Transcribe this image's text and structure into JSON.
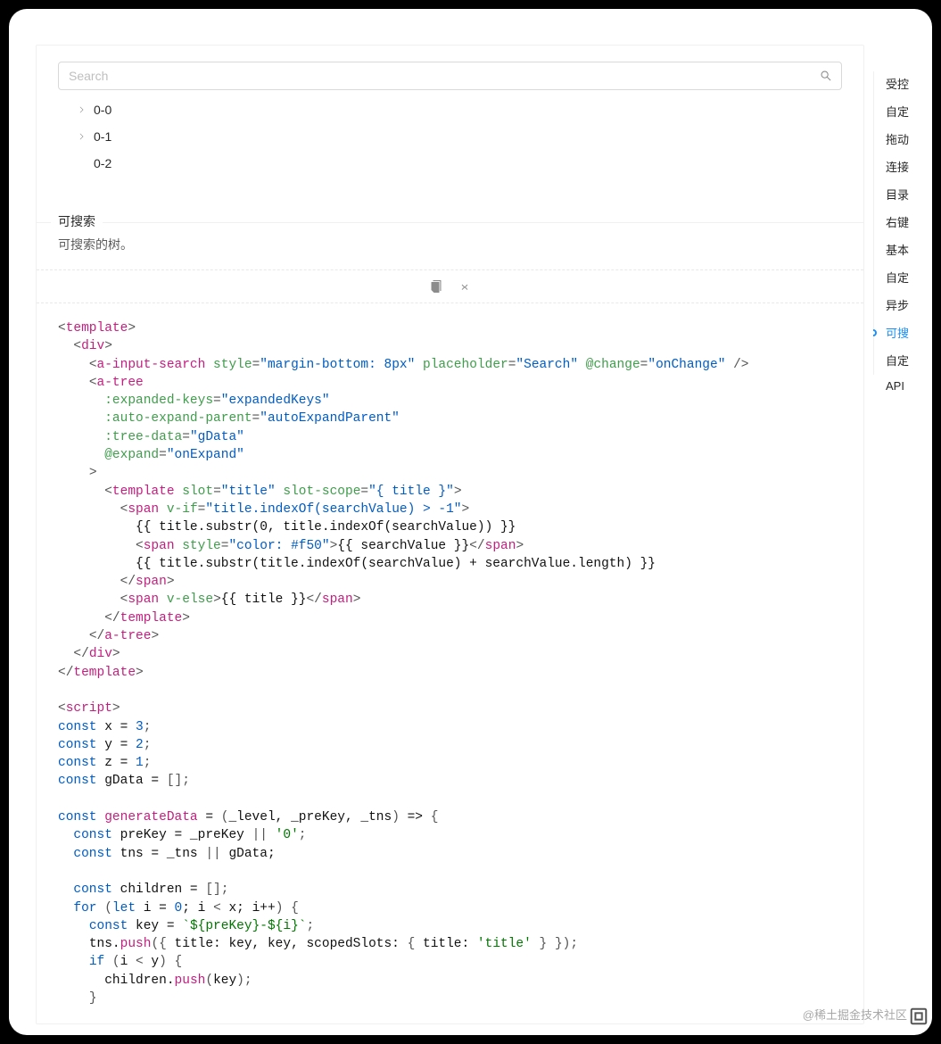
{
  "search": {
    "placeholder": "Search"
  },
  "tree": {
    "items": [
      {
        "title": "0-0",
        "hasChildren": true
      },
      {
        "title": "0-1",
        "hasChildren": true
      },
      {
        "title": "0-2",
        "hasChildren": false
      }
    ]
  },
  "meta": {
    "title": "可搜索",
    "desc": "可搜索的树。"
  },
  "code": {
    "tokens": [
      {
        "t": "<",
        "c": "punct"
      },
      {
        "t": "template",
        "c": "red"
      },
      {
        "t": ">",
        "c": "punct"
      },
      {
        "t": "\n  ",
        "c": "text"
      },
      {
        "t": "<",
        "c": "punct"
      },
      {
        "t": "div",
        "c": "red"
      },
      {
        "t": ">",
        "c": "punct"
      },
      {
        "t": "\n    ",
        "c": "text"
      },
      {
        "t": "<",
        "c": "punct"
      },
      {
        "t": "a-input-search",
        "c": "red"
      },
      {
        "t": " ",
        "c": "text"
      },
      {
        "t": "style",
        "c": "attr"
      },
      {
        "t": "=",
        "c": "punct"
      },
      {
        "t": "\"margin-bottom: 8px\"",
        "c": "dblue"
      },
      {
        "t": " ",
        "c": "text"
      },
      {
        "t": "placeholder",
        "c": "attr"
      },
      {
        "t": "=",
        "c": "punct"
      },
      {
        "t": "\"Search\"",
        "c": "dblue"
      },
      {
        "t": " ",
        "c": "text"
      },
      {
        "t": "@change",
        "c": "attr"
      },
      {
        "t": "=",
        "c": "punct"
      },
      {
        "t": "\"onChange\"",
        "c": "dblue"
      },
      {
        "t": " />",
        "c": "punct"
      },
      {
        "t": "\n    ",
        "c": "text"
      },
      {
        "t": "<",
        "c": "punct"
      },
      {
        "t": "a-tree",
        "c": "red"
      },
      {
        "t": "\n      ",
        "c": "text"
      },
      {
        "t": ":expanded-keys",
        "c": "attr"
      },
      {
        "t": "=",
        "c": "punct"
      },
      {
        "t": "\"expandedKeys\"",
        "c": "dblue"
      },
      {
        "t": "\n      ",
        "c": "text"
      },
      {
        "t": ":auto-expand-parent",
        "c": "attr"
      },
      {
        "t": "=",
        "c": "punct"
      },
      {
        "t": "\"autoExpandParent\"",
        "c": "dblue"
      },
      {
        "t": "\n      ",
        "c": "text"
      },
      {
        "t": ":tree-data",
        "c": "attr"
      },
      {
        "t": "=",
        "c": "punct"
      },
      {
        "t": "\"gData\"",
        "c": "dblue"
      },
      {
        "t": "\n      ",
        "c": "text"
      },
      {
        "t": "@expand",
        "c": "attr"
      },
      {
        "t": "=",
        "c": "punct"
      },
      {
        "t": "\"onExpand\"",
        "c": "dblue"
      },
      {
        "t": "\n    ",
        "c": "text"
      },
      {
        "t": ">",
        "c": "punct"
      },
      {
        "t": "\n      ",
        "c": "text"
      },
      {
        "t": "<",
        "c": "punct"
      },
      {
        "t": "template",
        "c": "red"
      },
      {
        "t": " ",
        "c": "text"
      },
      {
        "t": "slot",
        "c": "attr"
      },
      {
        "t": "=",
        "c": "punct"
      },
      {
        "t": "\"title\"",
        "c": "dblue"
      },
      {
        "t": " ",
        "c": "text"
      },
      {
        "t": "slot-scope",
        "c": "attr"
      },
      {
        "t": "=",
        "c": "punct"
      },
      {
        "t": "\"{ title }\"",
        "c": "dblue"
      },
      {
        "t": ">",
        "c": "punct"
      },
      {
        "t": "\n        ",
        "c": "text"
      },
      {
        "t": "<",
        "c": "punct"
      },
      {
        "t": "span",
        "c": "red"
      },
      {
        "t": " ",
        "c": "text"
      },
      {
        "t": "v-if",
        "c": "attr"
      },
      {
        "t": "=",
        "c": "punct"
      },
      {
        "t": "\"title.indexOf(searchValue) > -1\"",
        "c": "dblue"
      },
      {
        "t": ">",
        "c": "punct"
      },
      {
        "t": "\n          ",
        "c": "text"
      },
      {
        "t": "{{ title.substr(0, title.indexOf(searchValue)) }}",
        "c": "text"
      },
      {
        "t": "\n          ",
        "c": "text"
      },
      {
        "t": "<",
        "c": "punct"
      },
      {
        "t": "span",
        "c": "red"
      },
      {
        "t": " ",
        "c": "text"
      },
      {
        "t": "style",
        "c": "attr"
      },
      {
        "t": "=",
        "c": "punct"
      },
      {
        "t": "\"color: #f50\"",
        "c": "dblue"
      },
      {
        "t": ">",
        "c": "punct"
      },
      {
        "t": "{{ searchValue }}",
        "c": "text"
      },
      {
        "t": "</",
        "c": "punct"
      },
      {
        "t": "span",
        "c": "red"
      },
      {
        "t": ">",
        "c": "punct"
      },
      {
        "t": "\n          ",
        "c": "text"
      },
      {
        "t": "{{ title.substr(title.indexOf(searchValue) + searchValue.length) }}",
        "c": "text"
      },
      {
        "t": "\n        ",
        "c": "text"
      },
      {
        "t": "</",
        "c": "punct"
      },
      {
        "t": "span",
        "c": "red"
      },
      {
        "t": ">",
        "c": "punct"
      },
      {
        "t": "\n        ",
        "c": "text"
      },
      {
        "t": "<",
        "c": "punct"
      },
      {
        "t": "span",
        "c": "red"
      },
      {
        "t": " ",
        "c": "text"
      },
      {
        "t": "v-else",
        "c": "attr"
      },
      {
        "t": ">",
        "c": "punct"
      },
      {
        "t": "{{ title }}",
        "c": "text"
      },
      {
        "t": "</",
        "c": "punct"
      },
      {
        "t": "span",
        "c": "red"
      },
      {
        "t": ">",
        "c": "punct"
      },
      {
        "t": "\n      ",
        "c": "text"
      },
      {
        "t": "</",
        "c": "punct"
      },
      {
        "t": "template",
        "c": "red"
      },
      {
        "t": ">",
        "c": "punct"
      },
      {
        "t": "\n    ",
        "c": "text"
      },
      {
        "t": "</",
        "c": "punct"
      },
      {
        "t": "a-tree",
        "c": "red"
      },
      {
        "t": ">",
        "c": "punct"
      },
      {
        "t": "\n  ",
        "c": "text"
      },
      {
        "t": "</",
        "c": "punct"
      },
      {
        "t": "div",
        "c": "red"
      },
      {
        "t": ">",
        "c": "punct"
      },
      {
        "t": "\n",
        "c": "text"
      },
      {
        "t": "</",
        "c": "punct"
      },
      {
        "t": "template",
        "c": "red"
      },
      {
        "t": ">",
        "c": "punct"
      },
      {
        "t": "\n\n",
        "c": "text"
      },
      {
        "t": "<",
        "c": "punct"
      },
      {
        "t": "script",
        "c": "red"
      },
      {
        "t": ">",
        "c": "punct"
      },
      {
        "t": "\n",
        "c": "text"
      },
      {
        "t": "const",
        "c": "kw"
      },
      {
        "t": " x = ",
        "c": "text"
      },
      {
        "t": "3",
        "c": "num"
      },
      {
        "t": ";",
        "c": "punct"
      },
      {
        "t": "\n",
        "c": "text"
      },
      {
        "t": "const",
        "c": "kw"
      },
      {
        "t": " y = ",
        "c": "text"
      },
      {
        "t": "2",
        "c": "num"
      },
      {
        "t": ";",
        "c": "punct"
      },
      {
        "t": "\n",
        "c": "text"
      },
      {
        "t": "const",
        "c": "kw"
      },
      {
        "t": " z = ",
        "c": "text"
      },
      {
        "t": "1",
        "c": "num"
      },
      {
        "t": ";",
        "c": "punct"
      },
      {
        "t": "\n",
        "c": "text"
      },
      {
        "t": "const",
        "c": "kw"
      },
      {
        "t": " gData = ",
        "c": "text"
      },
      {
        "t": "[",
        "c": "punct"
      },
      {
        "t": "]",
        "c": "punct"
      },
      {
        "t": ";",
        "c": "punct"
      },
      {
        "t": "\n\n",
        "c": "text"
      },
      {
        "t": "const",
        "c": "kw"
      },
      {
        "t": " ",
        "c": "text"
      },
      {
        "t": "generateData",
        "c": "fn"
      },
      {
        "t": " = ",
        "c": "text"
      },
      {
        "t": "(",
        "c": "punct"
      },
      {
        "t": "_level, _preKey, _tns",
        "c": "text"
      },
      {
        "t": ")",
        "c": "punct"
      },
      {
        "t": " => ",
        "c": "text"
      },
      {
        "t": "{",
        "c": "punct"
      },
      {
        "t": "\n  ",
        "c": "text"
      },
      {
        "t": "const",
        "c": "kw"
      },
      {
        "t": " preKey = _preKey ",
        "c": "text"
      },
      {
        "t": "||",
        "c": "punct"
      },
      {
        "t": " ",
        "c": "text"
      },
      {
        "t": "'0'",
        "c": "grn2"
      },
      {
        "t": ";",
        "c": "punct"
      },
      {
        "t": "\n  ",
        "c": "text"
      },
      {
        "t": "const",
        "c": "kw"
      },
      {
        "t": " tns = _tns ",
        "c": "text"
      },
      {
        "t": "||",
        "c": "punct"
      },
      {
        "t": " gData;",
        "c": "text"
      },
      {
        "t": "\n\n  ",
        "c": "text"
      },
      {
        "t": "const",
        "c": "kw"
      },
      {
        "t": " children = ",
        "c": "text"
      },
      {
        "t": "[",
        "c": "punct"
      },
      {
        "t": "]",
        "c": "punct"
      },
      {
        "t": ";",
        "c": "punct"
      },
      {
        "t": "\n  ",
        "c": "text"
      },
      {
        "t": "for",
        "c": "kw"
      },
      {
        "t": " ",
        "c": "text"
      },
      {
        "t": "(",
        "c": "punct"
      },
      {
        "t": "let",
        "c": "kw"
      },
      {
        "t": " i = ",
        "c": "text"
      },
      {
        "t": "0",
        "c": "num"
      },
      {
        "t": "; i ",
        "c": "text"
      },
      {
        "t": "<",
        "c": "punct"
      },
      {
        "t": " x; i++",
        "c": "text"
      },
      {
        "t": ")",
        "c": "punct"
      },
      {
        "t": " ",
        "c": "text"
      },
      {
        "t": "{",
        "c": "punct"
      },
      {
        "t": "\n    ",
        "c": "text"
      },
      {
        "t": "const",
        "c": "kw"
      },
      {
        "t": " key = ",
        "c": "text"
      },
      {
        "t": "`${preKey}-${i}`",
        "c": "grn2"
      },
      {
        "t": ";",
        "c": "punct"
      },
      {
        "t": "\n    ",
        "c": "text"
      },
      {
        "t": "tns.",
        "c": "text"
      },
      {
        "t": "push",
        "c": "fn"
      },
      {
        "t": "(",
        "c": "punct"
      },
      {
        "t": "{",
        "c": "punct"
      },
      {
        "t": " title: key, key, scopedSlots: ",
        "c": "text"
      },
      {
        "t": "{",
        "c": "punct"
      },
      {
        "t": " title: ",
        "c": "text"
      },
      {
        "t": "'title'",
        "c": "grn2"
      },
      {
        "t": " ",
        "c": "text"
      },
      {
        "t": "}",
        "c": "punct"
      },
      {
        "t": " ",
        "c": "text"
      },
      {
        "t": "}",
        "c": "punct"
      },
      {
        "t": ")",
        "c": "punct"
      },
      {
        "t": ";",
        "c": "punct"
      },
      {
        "t": "\n    ",
        "c": "text"
      },
      {
        "t": "if",
        "c": "kw"
      },
      {
        "t": " ",
        "c": "text"
      },
      {
        "t": "(",
        "c": "punct"
      },
      {
        "t": "i ",
        "c": "text"
      },
      {
        "t": "<",
        "c": "punct"
      },
      {
        "t": " y",
        "c": "text"
      },
      {
        "t": ")",
        "c": "punct"
      },
      {
        "t": " ",
        "c": "text"
      },
      {
        "t": "{",
        "c": "punct"
      },
      {
        "t": "\n      ",
        "c": "text"
      },
      {
        "t": "children.",
        "c": "text"
      },
      {
        "t": "push",
        "c": "fn"
      },
      {
        "t": "(",
        "c": "punct"
      },
      {
        "t": "key",
        "c": "text"
      },
      {
        "t": ")",
        "c": "punct"
      },
      {
        "t": ";",
        "c": "punct"
      },
      {
        "t": "\n    ",
        "c": "text"
      },
      {
        "t": "}",
        "c": "punct"
      }
    ]
  },
  "anchors": [
    {
      "label": "受控",
      "active": false
    },
    {
      "label": "自定",
      "active": false
    },
    {
      "label": "拖动",
      "active": false
    },
    {
      "label": "连接",
      "active": false
    },
    {
      "label": "目录",
      "active": false
    },
    {
      "label": "右键",
      "active": false
    },
    {
      "label": "基本",
      "active": false
    },
    {
      "label": "自定",
      "active": false
    },
    {
      "label": "异步",
      "active": false
    },
    {
      "label": "可搜",
      "active": true
    },
    {
      "label": "自定",
      "active": false
    },
    {
      "label": "API",
      "active": false
    }
  ],
  "watermark": "@稀土掘金技术社区"
}
